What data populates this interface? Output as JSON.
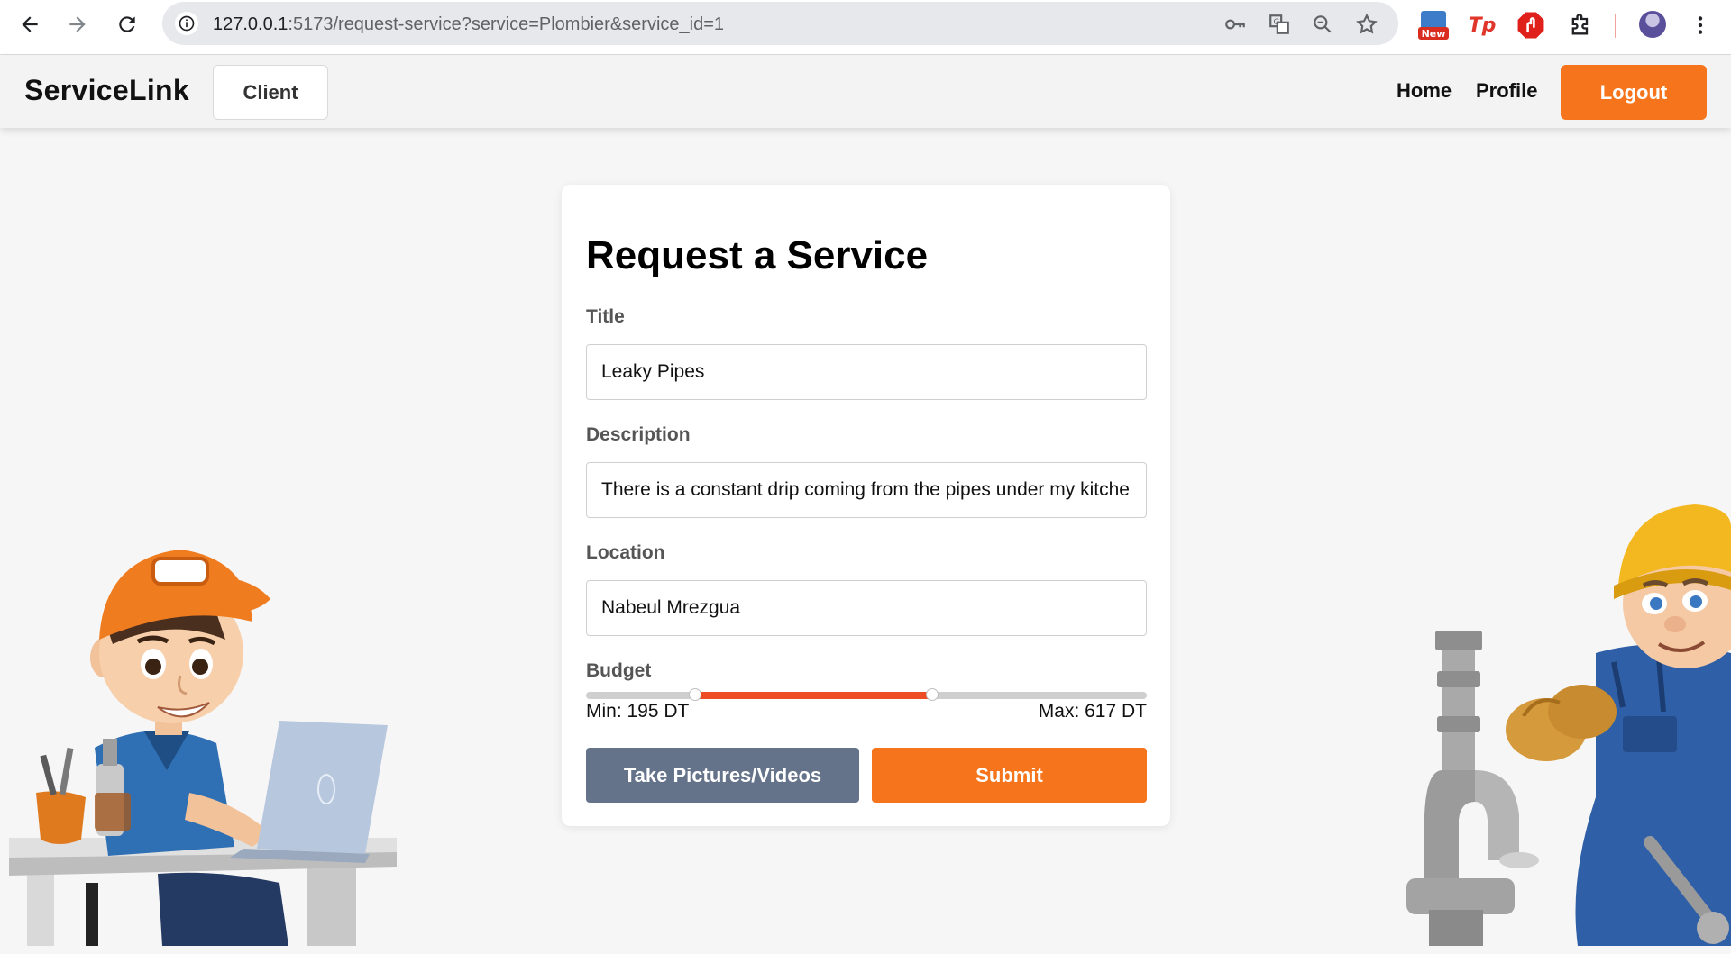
{
  "browser": {
    "url_host": "127.0.0.1",
    "url_path": ":5173/request-service?service=Plombier&service_id=1",
    "extension_badge": "New",
    "tp_label": "Tp"
  },
  "header": {
    "brand": "ServiceLink",
    "role_label": "Client",
    "nav": {
      "home": "Home",
      "profile": "Profile"
    },
    "logout_label": "Logout"
  },
  "form": {
    "title": "Request a Service",
    "title_label": "Title",
    "title_value": "Leaky Pipes",
    "description_label": "Description",
    "description_value": "There is a constant drip coming from the pipes under my kitchen sink",
    "location_label": "Location",
    "location_value": "Nabeul Mrezgua",
    "budget_label": "Budget",
    "budget_min_text": "Min: 195 DT",
    "budget_max_text": "Max: 617 DT",
    "budget_min_fraction": 0.195,
    "budget_max_fraction": 0.617,
    "media_button": "Take Pictures/Videos",
    "submit_button": "Submit"
  },
  "colors": {
    "accent": "#f6741b",
    "slider_fill": "#ee4c25",
    "secondary_button": "#65738a"
  }
}
